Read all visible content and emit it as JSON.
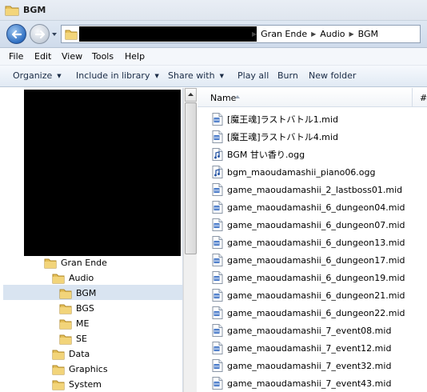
{
  "window": {
    "title": "BGM"
  },
  "address": {
    "crumbs": [
      "Gran Ende",
      "Audio",
      "BGM"
    ]
  },
  "menu": [
    "File",
    "Edit",
    "View",
    "Tools",
    "Help"
  ],
  "toolbar": {
    "organize": "Organize",
    "include": "Include in library",
    "share": "Share with",
    "playall": "Play all",
    "burn": "Burn",
    "newfolder": "New folder"
  },
  "nav": {
    "items": [
      {
        "label": "Gran Ende",
        "selected": false
      },
      {
        "label": "Audio",
        "selected": false
      },
      {
        "label": "BGM",
        "selected": true
      },
      {
        "label": "BGS",
        "selected": false
      },
      {
        "label": "ME",
        "selected": false
      },
      {
        "label": "SE",
        "selected": false
      },
      {
        "label": "Data",
        "selected": false
      },
      {
        "label": "Graphics",
        "selected": false
      },
      {
        "label": "System",
        "selected": false
      }
    ]
  },
  "files": {
    "header_name": "Name",
    "header_more": "#",
    "items": [
      {
        "name": "[魔王魂]ラストバトル1.mid",
        "icon": "midi-file-icon"
      },
      {
        "name": "[魔王魂]ラストバトル4.mid",
        "icon": "midi-file-icon"
      },
      {
        "name": "BGM 甘い香り.ogg",
        "icon": "ogg-file-icon"
      },
      {
        "name": "bgm_maoudamashii_piano06.ogg",
        "icon": "ogg-file-icon"
      },
      {
        "name": "game_maoudamashii_2_lastboss01.mid",
        "icon": "midi-file-icon"
      },
      {
        "name": "game_maoudamashii_6_dungeon04.mid",
        "icon": "midi-file-icon"
      },
      {
        "name": "game_maoudamashii_6_dungeon07.mid",
        "icon": "midi-file-icon"
      },
      {
        "name": "game_maoudamashii_6_dungeon13.mid",
        "icon": "midi-file-icon"
      },
      {
        "name": "game_maoudamashii_6_dungeon17.mid",
        "icon": "midi-file-icon"
      },
      {
        "name": "game_maoudamashii_6_dungeon19.mid",
        "icon": "midi-file-icon"
      },
      {
        "name": "game_maoudamashii_6_dungeon21.mid",
        "icon": "midi-file-icon"
      },
      {
        "name": "game_maoudamashii_6_dungeon22.mid",
        "icon": "midi-file-icon"
      },
      {
        "name": "game_maoudamashii_7_event08.mid",
        "icon": "midi-file-icon"
      },
      {
        "name": "game_maoudamashii_7_event12.mid",
        "icon": "midi-file-icon"
      },
      {
        "name": "game_maoudamashii_7_event32.mid",
        "icon": "midi-file-icon"
      },
      {
        "name": "game_maoudamashii_7_event43.mid",
        "icon": "midi-file-icon"
      }
    ]
  }
}
